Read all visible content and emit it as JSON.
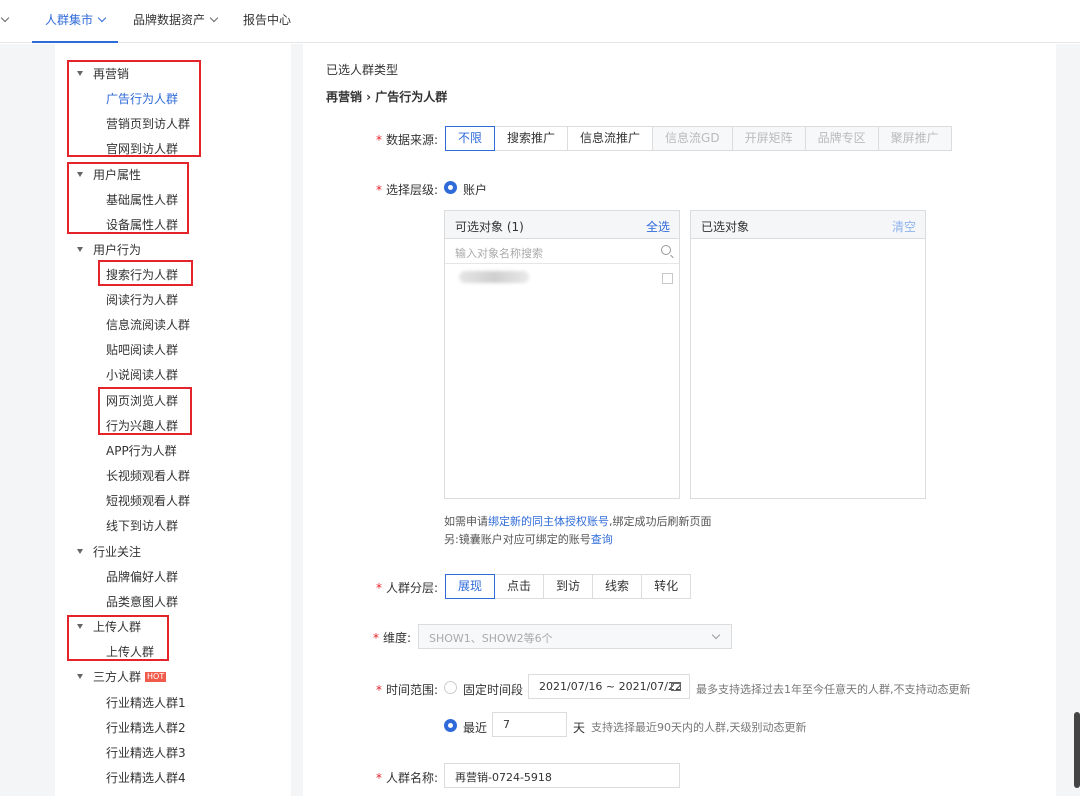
{
  "topnav": {
    "items": [
      {
        "label": "人群集市"
      },
      {
        "label": "品牌数据资产"
      },
      {
        "label": "报告中心"
      }
    ]
  },
  "sidebar": {
    "groups": [
      {
        "label": "再营销",
        "items": [
          "广告行为人群",
          "营销页到访人群",
          "官网到访人群"
        ]
      },
      {
        "label": "用户属性",
        "items": [
          "基础属性人群",
          "设备属性人群"
        ]
      },
      {
        "label": "用户行为",
        "items": [
          "搜索行为人群",
          "阅读行为人群",
          "信息流阅读人群",
          "贴吧阅读人群",
          "小说阅读人群",
          "网页浏览人群",
          "行为兴趣人群",
          "APP行为人群",
          "长视频观看人群",
          "短视频观看人群",
          "线下到访人群"
        ]
      },
      {
        "label": "行业关注",
        "items": [
          "品牌偏好人群",
          "品类意图人群"
        ]
      },
      {
        "label": "上传人群",
        "items": [
          "上传人群"
        ]
      },
      {
        "label": "三方人群",
        "badge": "HOT",
        "items": [
          "行业精选人群1",
          "行业精选人群2",
          "行业精选人群3",
          "行业精选人群4"
        ]
      }
    ]
  },
  "main": {
    "selected_type_label": "已选人群类型",
    "breadcrumb": "再营销 › 广告行为人群",
    "data_source": {
      "label": "数据来源:",
      "options": [
        "不限",
        "搜索推广",
        "信息流推广",
        "信息流GD",
        "开屏矩阵",
        "品牌专区",
        "聚屏推广"
      ],
      "selected": "不限"
    },
    "level": {
      "label": "选择层级:",
      "option": "账户"
    },
    "available_panel": {
      "title": "可选对象 (1)",
      "action": "全选",
      "search_placeholder": "输入对象名称搜索"
    },
    "selected_panel": {
      "title": "已选对象",
      "action": "清空"
    },
    "note1": {
      "prefix": "如需申请",
      "link": "绑定新的同主体授权账号",
      "suffix": ",绑定成功后刷新页面"
    },
    "note2": {
      "prefix": "另:镜囊账户对应可绑定的账号",
      "link": "查询"
    },
    "layer": {
      "label": "人群分层:",
      "options": [
        "展现",
        "点击",
        "到访",
        "线索",
        "转化"
      ],
      "selected": "展现"
    },
    "dimension": {
      "label": "维度:",
      "value": "SHOW1、SHOW2等6个"
    },
    "time_range": {
      "label": "时间范围:",
      "fixed_label": "固定时间段",
      "date_range": "2021/07/16 ~ 2021/07/22",
      "fixed_hint": "最多支持选择过去1年至今任意天的人群,不支持动态更新",
      "recent_label": "最近",
      "recent_days": "7",
      "recent_unit": "天",
      "recent_hint": "支持选择最近90天内的人群,天级别动态更新"
    },
    "name": {
      "label": "人群名称:",
      "value": "再营销-0724-5918"
    }
  }
}
